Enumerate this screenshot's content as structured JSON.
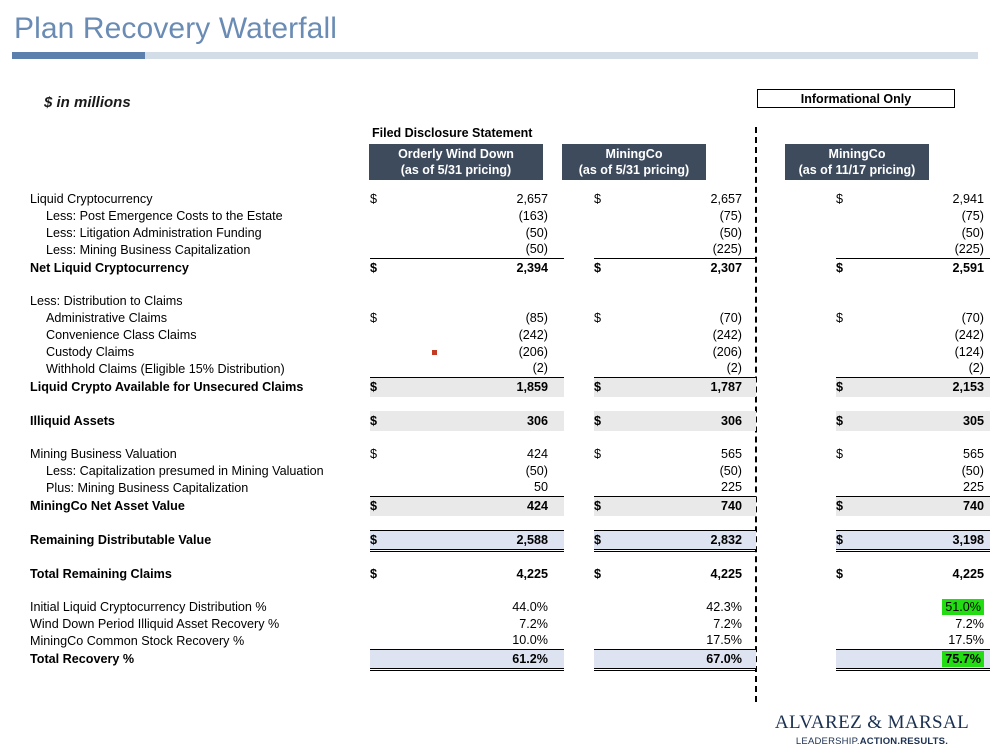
{
  "slide": {
    "title": "Plan Recovery Waterfall",
    "units_note": "$ in millions",
    "accent_dark": "#5b80ad",
    "accent_light": "#d3dde8",
    "header_chip_color": "#3e4b5d",
    "highlight_green": "#22dd11",
    "highlight_blue": "#dde3f0",
    "highlight_gray": "#e9e9e9"
  },
  "badges": {
    "informational_only": "Informational Only",
    "filed_disclosure_statement": "Filed Disclosure Statement"
  },
  "columns": [
    {
      "name": "MiningCo Orderly Wind Down 5/31",
      "line1": "Orderly Wind Down",
      "line2": "(as of 5/31 pricing)"
    },
    {
      "name": "MiningCo 5/31",
      "line1": "MiningCo",
      "line2": "(as of 5/31 pricing)"
    },
    {
      "name": "MiningCo 11/17",
      "line1": "MiningCo",
      "line2": "(as of 11/17 pricing)"
    }
  ],
  "rows": [
    {
      "label": "Liquid Cryptocurrency",
      "c0": "2,657",
      "c1": "2,657",
      "c2": "2,941",
      "cur": "$"
    },
    {
      "label": "Less: Post Emergence Costs to the Estate",
      "c0": "(163)",
      "c1": "(75)",
      "c2": "(75)",
      "cur": ""
    },
    {
      "label": "Less: Litigation Administration Funding",
      "c0": "(50)",
      "c1": "(50)",
      "c2": "(50)",
      "cur": ""
    },
    {
      "label": "Less: Mining Business Capitalization",
      "c0": "(50)",
      "c1": "(225)",
      "c2": "(225)",
      "cur": ""
    },
    {
      "label": "Net Liquid Cryptocurrency",
      "c0": "2,394",
      "c1": "2,307",
      "c2": "2,591",
      "cur": "$"
    },
    {
      "label": "Less: Distribution to Claims",
      "c0": "",
      "c1": "",
      "c2": "",
      "cur": ""
    },
    {
      "label": "Administrative Claims",
      "c0": "(85)",
      "c1": "(70)",
      "c2": "(70)",
      "cur": "$"
    },
    {
      "label": "Convenience Class Claims",
      "c0": "(242)",
      "c1": "(242)",
      "c2": "(242)",
      "cur": ""
    },
    {
      "label": "Custody Claims",
      "c0": "(206)",
      "c1": "(206)",
      "c2": "(124)",
      "cur": ""
    },
    {
      "label": "Withhold Claims (Eligible 15% Distribution)",
      "c0": "(2)",
      "c1": "(2)",
      "c2": "(2)",
      "cur": ""
    },
    {
      "label": "Liquid Crypto Available for Unsecured Claims",
      "c0": "1,859",
      "c1": "1,787",
      "c2": "2,153",
      "cur": "$"
    },
    {
      "label": "Illiquid Assets",
      "c0": "306",
      "c1": "306",
      "c2": "305",
      "cur": "$"
    },
    {
      "label": "Mining Business Valuation",
      "c0": "424",
      "c1": "565",
      "c2": "565",
      "cur": "$"
    },
    {
      "label": "Less: Capitalization presumed in Mining Valuation",
      "c0": "(50)",
      "c1": "(50)",
      "c2": "(50)",
      "cur": ""
    },
    {
      "label": "Plus: Mining Business Capitalization",
      "c0": "50",
      "c1": "225",
      "c2": "225",
      "cur": ""
    },
    {
      "label": "MiningCo Net Asset Value",
      "c0": "424",
      "c1": "740",
      "c2": "740",
      "cur": "$"
    },
    {
      "label": "Remaining Distributable Value",
      "c0": "2,588",
      "c1": "2,832",
      "c2": "3,198",
      "cur": "$"
    },
    {
      "label": "Total Remaining Claims",
      "c0": "4,225",
      "c1": "4,225",
      "c2": "4,225",
      "cur": "$"
    },
    {
      "label": "Initial Liquid Cryptocurrency Distribution %",
      "c0": "44.0%",
      "c1": "42.3%",
      "c2": "51.0%",
      "cur": ""
    },
    {
      "label": "Wind Down Period Illiquid Asset Recovery %",
      "c0": "7.2%",
      "c1": "7.2%",
      "c2": "7.2%",
      "cur": ""
    },
    {
      "label": "MiningCo Common Stock Recovery %",
      "c0": "10.0%",
      "c1": "17.5%",
      "c2": "17.5%",
      "cur": ""
    },
    {
      "label": "Total Recovery %",
      "c0": "61.2%",
      "c1": "67.0%",
      "c2": "75.7%",
      "cur": ""
    }
  ],
  "footer": {
    "logo_name": "ALVAREZ & MARSAL",
    "tagline_lead": "LEADERSHIP.",
    "tagline_strong_1": "ACTION.",
    "tagline_strong_2": "RESULTS."
  }
}
